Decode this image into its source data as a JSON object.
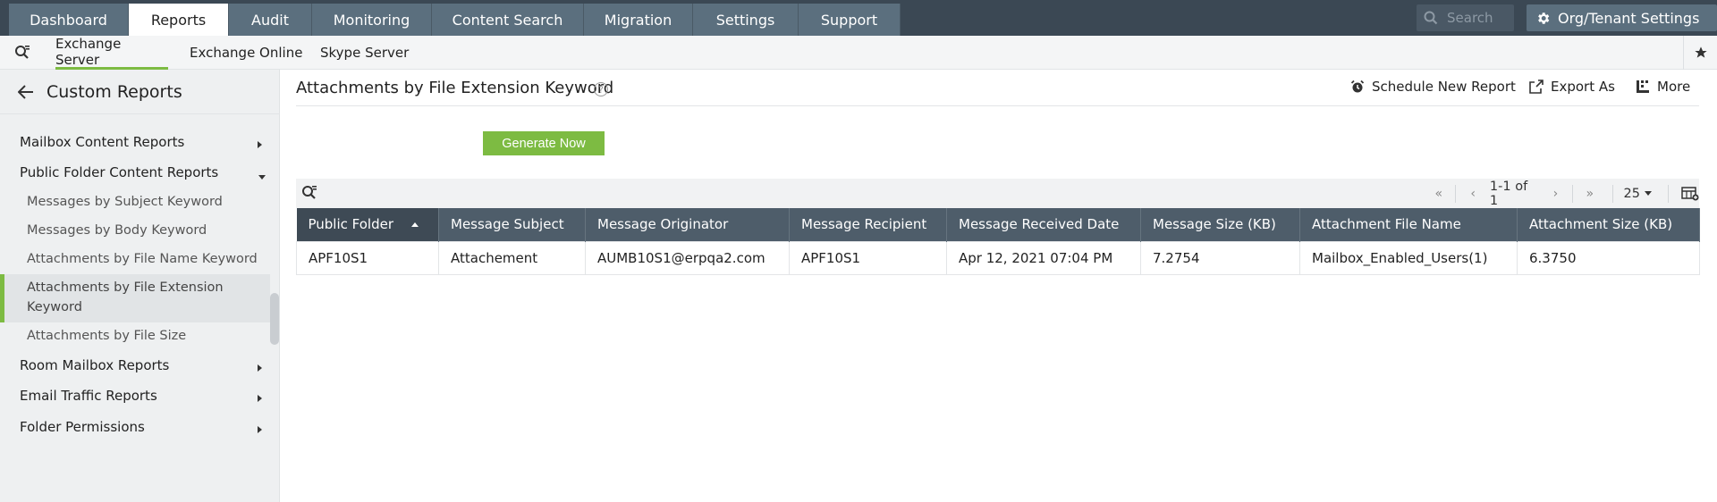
{
  "topnav": {
    "tabs": [
      {
        "label": "Dashboard"
      },
      {
        "label": "Reports"
      },
      {
        "label": "Audit"
      },
      {
        "label": "Monitoring"
      },
      {
        "label": "Content Search"
      },
      {
        "label": "Migration"
      },
      {
        "label": "Settings"
      },
      {
        "label": "Support"
      }
    ],
    "active_tab": "Reports",
    "search_placeholder": "Search",
    "org_settings_label": "Org/Tenant Settings"
  },
  "subnav": {
    "tabs": [
      {
        "label": "Exchange Server"
      },
      {
        "label": "Exchange Online"
      },
      {
        "label": "Skype Server"
      }
    ],
    "active_tab": "Exchange Server"
  },
  "sidebar": {
    "title": "Custom Reports",
    "groups": [
      {
        "label": "Mailbox Content Reports",
        "expanded": false
      },
      {
        "label": "Public Folder Content Reports",
        "expanded": true,
        "items": [
          {
            "label": "Messages by Subject Keyword"
          },
          {
            "label": "Messages by Body Keyword"
          },
          {
            "label": "Attachments by File Name Keyword"
          },
          {
            "label": "Attachments by File Extension Keyword",
            "active": true
          },
          {
            "label": "Attachments by File Size"
          }
        ]
      },
      {
        "label": "Room Mailbox Reports",
        "expanded": false
      },
      {
        "label": "Email Traffic Reports",
        "expanded": false
      },
      {
        "label": "Folder Permissions",
        "expanded": false
      }
    ]
  },
  "main": {
    "title": "Attachments by File Extension Keyword",
    "help_glyph": "?",
    "actions": {
      "schedule": "Schedule New Report",
      "export": "Export As",
      "more": "More"
    },
    "generate_label": "Generate Now",
    "pager": {
      "range": "1-1 of 1",
      "page_size": "25"
    },
    "table": {
      "columns": [
        "Public Folder",
        "Message Subject",
        "Message Originator",
        "Message Recipient",
        "Message Received Date",
        "Message Size (KB)",
        "Attachment File Name",
        "Attachment Size (KB)"
      ],
      "rows": [
        [
          "APF10S1",
          "Attachement",
          "AUMB10S1@erpqa2.com",
          "APF10S1",
          "Apr 12, 2021 07:04 PM",
          "7.2754",
          "Mailbox_Enabled_Users(1)",
          "6.3750"
        ]
      ]
    }
  },
  "colors": {
    "accent": "#7dbb42",
    "topbar": "#3b4854",
    "header": "#4e5d6a"
  }
}
